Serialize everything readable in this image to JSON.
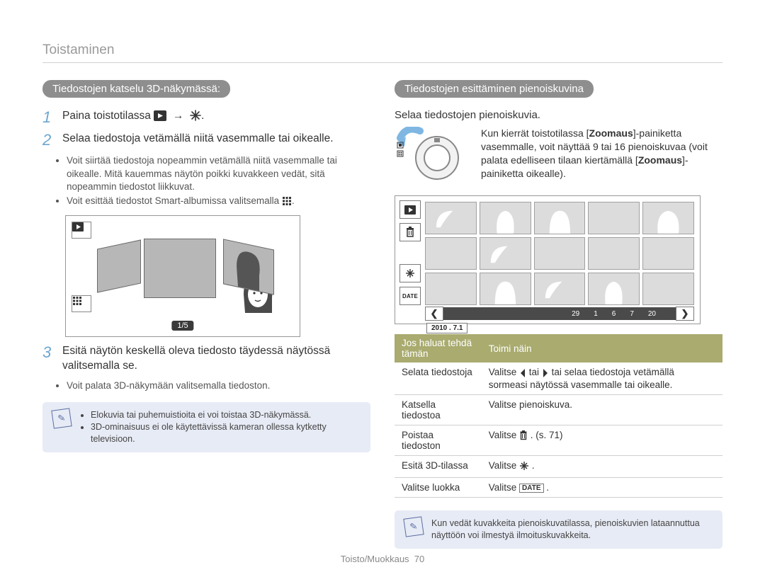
{
  "header": {
    "title": "Toistaminen"
  },
  "left": {
    "section_title": "Tiedostojen katselu 3D-näkymässä:",
    "step1_prefix": "Paina toistotilassa ",
    "step2": "Selaa tiedostoja vetämällä niitä vasemmalle tai oikealle.",
    "bullets2": [
      "Voit siirtää tiedostoja nopeammin vetämällä niitä vasemmalle tai oikealle. Mitä kauemmas näytön poikki kuvakkeen vedät, sitä nopeammin tiedostot liikkuvat.",
      "Voit esittää tiedostot Smart-albumissa valitsemalla "
    ],
    "counter": "1/5",
    "step3": "Esitä näytön keskellä oleva tiedosto täydessä näytössä valitsemalla se.",
    "bullets3": [
      "Voit palata 3D-näkymään valitsemalla tiedoston."
    ],
    "note": [
      "Elokuvia tai puhemuistioita ei voi toistaa 3D-näkymässä.",
      "3D-ominaisuus ei ole käytettävissä kameran ollessa kytketty televisioon."
    ]
  },
  "right": {
    "section_title": "Tiedostojen esittäminen pienoiskuvina",
    "intro": "Selaa tiedostojen pienoiskuvia.",
    "zoom_text_pre": "Kun kierrät toistotilassa [",
    "zoom_word": "Zoomaus",
    "zoom_text_mid1": "]-painiketta vasemmalle, voit näyttää 9 tai 16 pienoiskuvaa (voit palata edelliseen tilaan kiertämällä [",
    "zoom_text_mid2": "]-painiketta oikealle).",
    "days": [
      "29",
      "1",
      "6",
      "7",
      "20"
    ],
    "date": "2010 . 7.1",
    "table": {
      "headers": [
        "Jos haluat tehdä tämän",
        "Toimi näin"
      ],
      "rows": [
        {
          "action": "Selata tiedostoja",
          "how_prefix": "Valitse ",
          "how_middle": " tai ",
          "how_suffix": " tai selaa tiedostoja vetämällä sormeasi näytössä vasemmalle tai oikealle."
        },
        {
          "action": "Katsella tiedostoa",
          "how": "Valitse pienoiskuva."
        },
        {
          "action": "Poistaa tiedoston",
          "how_prefix": "Valitse ",
          "how_suffix": ". (s. 71)"
        },
        {
          "action": "Esitä 3D-tilassa",
          "how_prefix": "Valitse ",
          "how_suffix": "."
        },
        {
          "action": "Valitse luokka",
          "how_prefix": "Valitse ",
          "how_suffix": "."
        }
      ]
    },
    "bottom_note": "Kun vedät kuvakkeita pienoiskuvatilassa, pienoiskuvien lataannuttua näyttöön voi ilmestyä ilmoituskuvakkeita."
  },
  "footer": {
    "section": "Toisto/Muokkaus",
    "page": "70"
  }
}
